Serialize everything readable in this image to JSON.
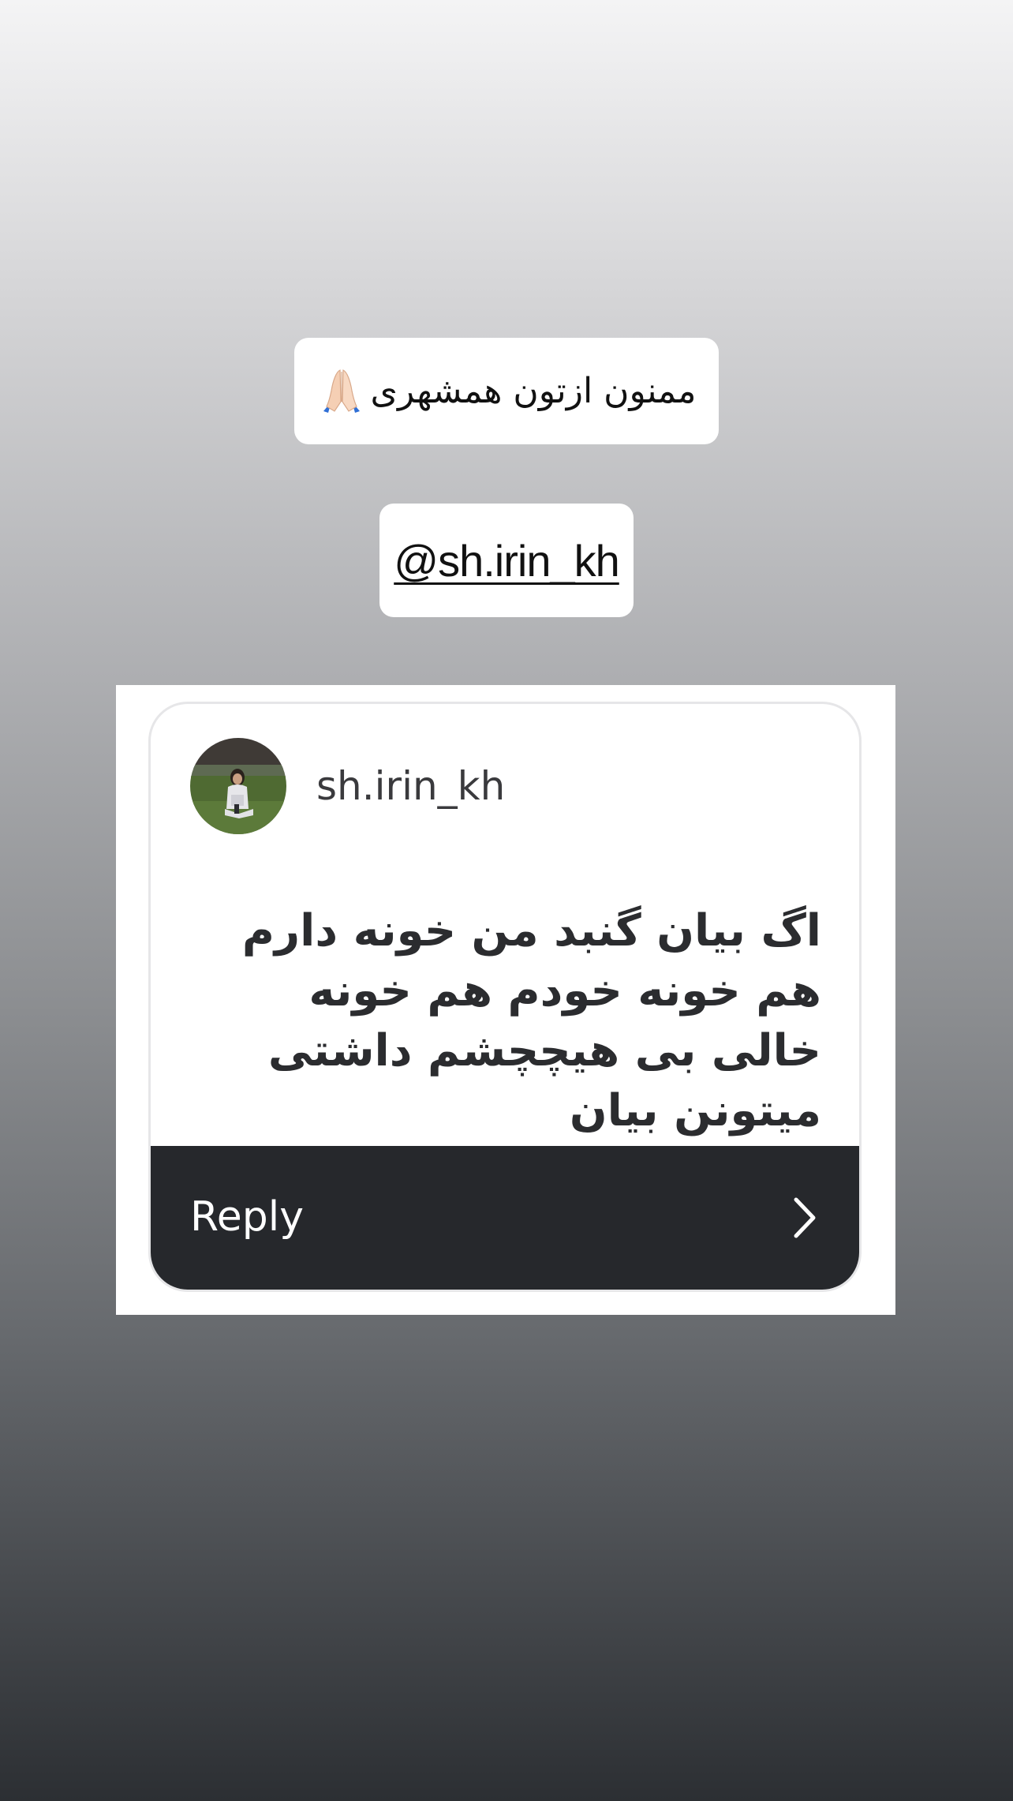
{
  "story": {
    "caption": "ممنون ازتون همشهری",
    "caption_emoji": "folded-hands-icon",
    "mention": "@sh.irin_kh"
  },
  "question_card": {
    "username": "sh.irin_kh",
    "avatar": "avatar",
    "question": "اگ بیان گنبد من خونه دارم هم خونه خودم هم خونه خالی بی هیچچشم داشتی میتونن بیان",
    "reply_label": "Reply",
    "reply_icon": "chevron-right-icon"
  },
  "colors": {
    "card_footer": "#26282c",
    "card_background": "#ffffff",
    "sticker_background": "#ffffff",
    "text_primary": "#111111",
    "question_text": "#2b2c2f"
  }
}
